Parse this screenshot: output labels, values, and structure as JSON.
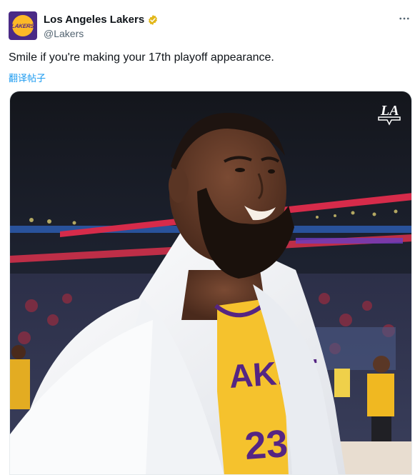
{
  "account": {
    "name": "Los Angeles Lakers",
    "handle": "@Lakers",
    "avatar_text": "LAKERS",
    "verified": true,
    "verified_badge_color": "#e2b719"
  },
  "tweet": {
    "text": "Smile if you're making your 17th playoff appearance.",
    "translate_label": "翻译帖子",
    "more_icon": "more-horizontal-icon"
  },
  "media": {
    "jersey_text": "AKEF",
    "jersey_number": "23",
    "watermark_text": "LA"
  },
  "colors": {
    "lakers_purple": "#552583",
    "lakers_gold": "#fdb927",
    "link_blue": "#1d9bf0",
    "muted_text": "#536471"
  }
}
